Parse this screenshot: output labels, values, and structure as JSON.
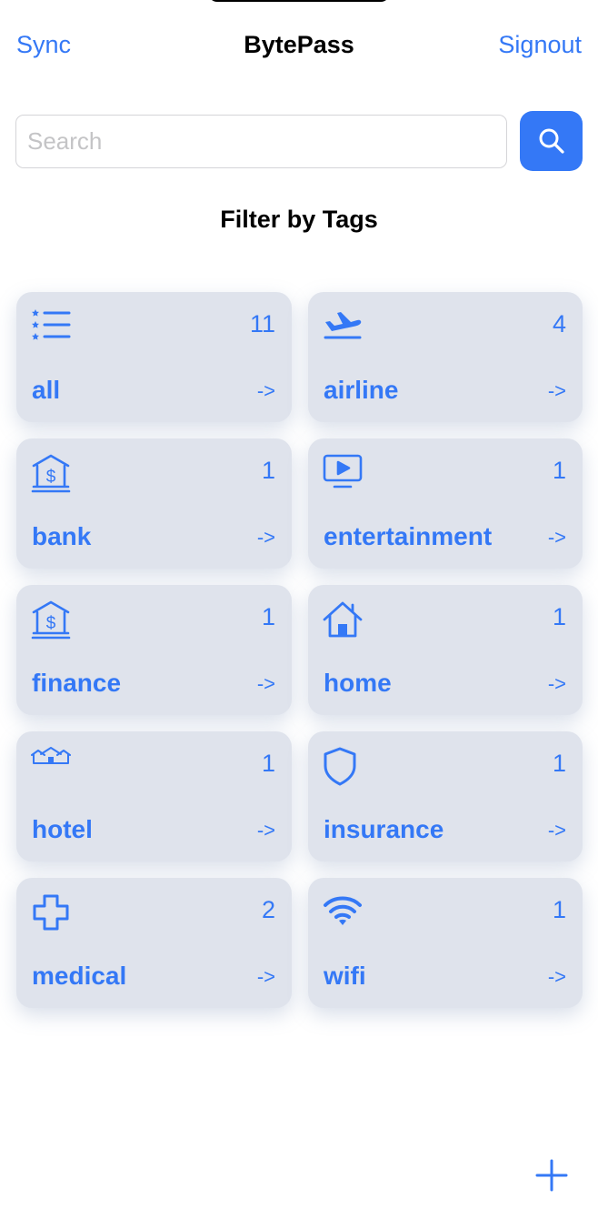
{
  "nav": {
    "left": "Sync",
    "title": "BytePass",
    "right": "Signout"
  },
  "search": {
    "placeholder": "Search"
  },
  "section_title": "Filter by Tags",
  "tags": [
    {
      "label": "all",
      "count": "11",
      "arrow": "->",
      "icon": "list-stars-icon"
    },
    {
      "label": "airline",
      "count": "4",
      "arrow": "->",
      "icon": "airplane-icon"
    },
    {
      "label": "bank",
      "count": "1",
      "arrow": "->",
      "icon": "bank-icon"
    },
    {
      "label": "entertainment",
      "count": "1",
      "arrow": "->",
      "icon": "play-rectangle-icon"
    },
    {
      "label": "finance",
      "count": "1",
      "arrow": "->",
      "icon": "bank-icon"
    },
    {
      "label": "home",
      "count": "1",
      "arrow": "->",
      "icon": "house-icon"
    },
    {
      "label": "hotel",
      "count": "1",
      "arrow": "->",
      "icon": "houses-icon"
    },
    {
      "label": "insurance",
      "count": "1",
      "arrow": "->",
      "icon": "shield-icon"
    },
    {
      "label": "medical",
      "count": "2",
      "arrow": "->",
      "icon": "cross-icon"
    },
    {
      "label": "wifi",
      "count": "1",
      "arrow": "->",
      "icon": "wifi-icon"
    }
  ],
  "colors": {
    "accent": "#3478f6",
    "card_bg": "#dfe3ec"
  }
}
